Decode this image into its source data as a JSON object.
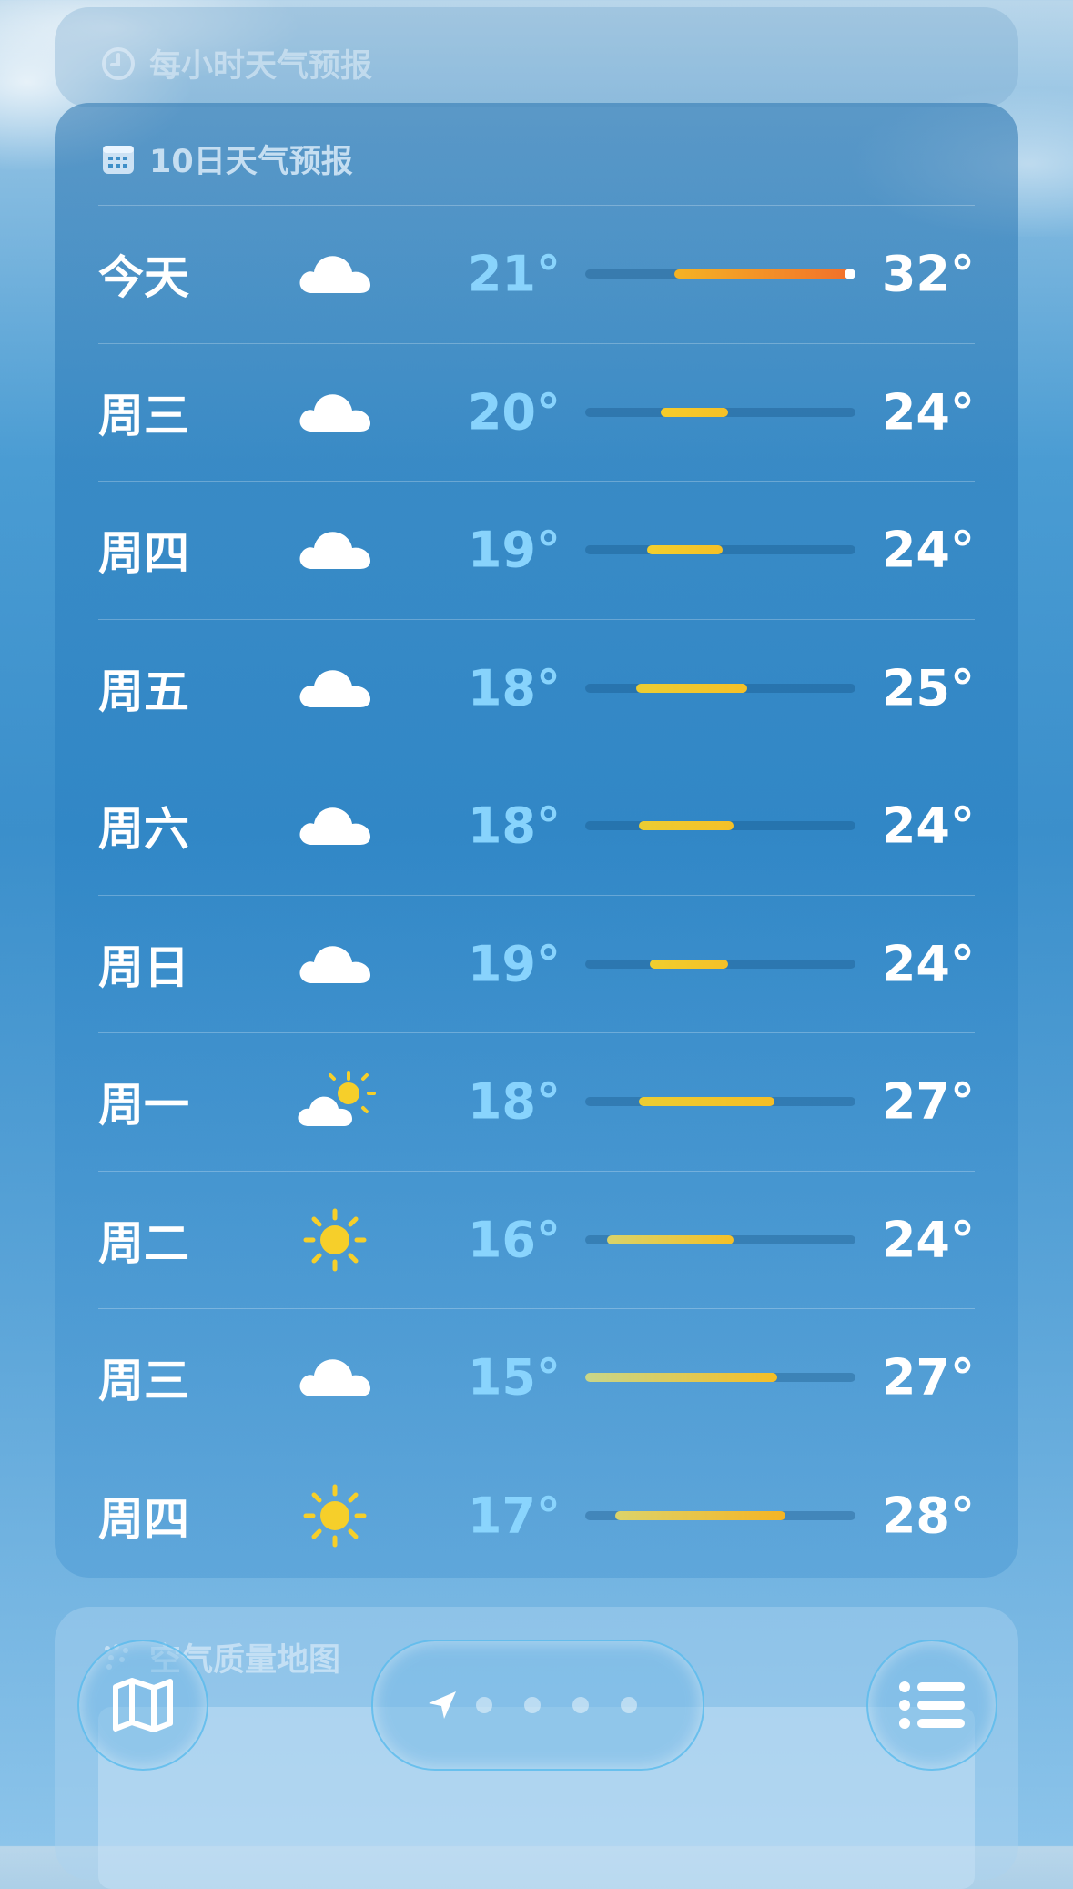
{
  "hourly_section": {
    "title": "每小时天气预报",
    "icon": "clock-icon"
  },
  "forecast_section": {
    "title": "10日天气预报",
    "icon": "calendar-icon",
    "days": [
      {
        "day": "今天",
        "icon": "cloud-icon",
        "low": "21°",
        "high": "32°",
        "bar_start": 0.33,
        "bar_end": 0.98,
        "current_marker": 0.98,
        "colors": [
          "#f5b324",
          "#f2702a"
        ]
      },
      {
        "day": "周三",
        "icon": "cloud-icon",
        "low": "20°",
        "high": "24°",
        "bar_start": 0.28,
        "bar_end": 0.53,
        "colors": [
          "#f6cc2a",
          "#f5c028"
        ]
      },
      {
        "day": "周四",
        "icon": "cloud-icon",
        "low": "19°",
        "high": "24°",
        "bar_start": 0.23,
        "bar_end": 0.51,
        "colors": [
          "#f3cf2c",
          "#f5c028"
        ]
      },
      {
        "day": "周五",
        "icon": "cloud-icon",
        "low": "18°",
        "high": "25°",
        "bar_start": 0.19,
        "bar_end": 0.6,
        "colors": [
          "#eccd33",
          "#f5c028"
        ]
      },
      {
        "day": "周六",
        "icon": "cloud-icon",
        "low": "18°",
        "high": "24°",
        "bar_start": 0.2,
        "bar_end": 0.55,
        "colors": [
          "#eccd33",
          "#f5c028"
        ]
      },
      {
        "day": "周日",
        "icon": "cloud-icon",
        "low": "19°",
        "high": "24°",
        "bar_start": 0.24,
        "bar_end": 0.53,
        "colors": [
          "#f0ce2e",
          "#f5c028"
        ]
      },
      {
        "day": "周一",
        "icon": "partly-sunny-icon",
        "low": "18°",
        "high": "27°",
        "bar_start": 0.2,
        "bar_end": 0.7,
        "colors": [
          "#eccd33",
          "#f5be26"
        ]
      },
      {
        "day": "周二",
        "icon": "sun-icon",
        "low": "16°",
        "high": "24°",
        "bar_start": 0.08,
        "bar_end": 0.55,
        "colors": [
          "#d9d36a",
          "#f5c028"
        ]
      },
      {
        "day": "周三",
        "icon": "cloud-icon",
        "low": "15°",
        "high": "27°",
        "bar_start": 0.0,
        "bar_end": 0.71,
        "colors": [
          "#c8d68a",
          "#f5be26"
        ]
      },
      {
        "day": "周四",
        "icon": "sun-icon",
        "low": "17°",
        "high": "28°",
        "bar_start": 0.11,
        "bar_end": 0.74,
        "colors": [
          "#dcd36a",
          "#f5b424"
        ]
      }
    ]
  },
  "air_quality_section": {
    "title": "空气质量地图",
    "icon": "air-quality-icon"
  },
  "bottom_bar": {
    "map_button_icon": "map-icon",
    "location_icon": "location-arrow-icon",
    "page_count": 5,
    "current_page": 0,
    "list_button_icon": "list-icon"
  }
}
